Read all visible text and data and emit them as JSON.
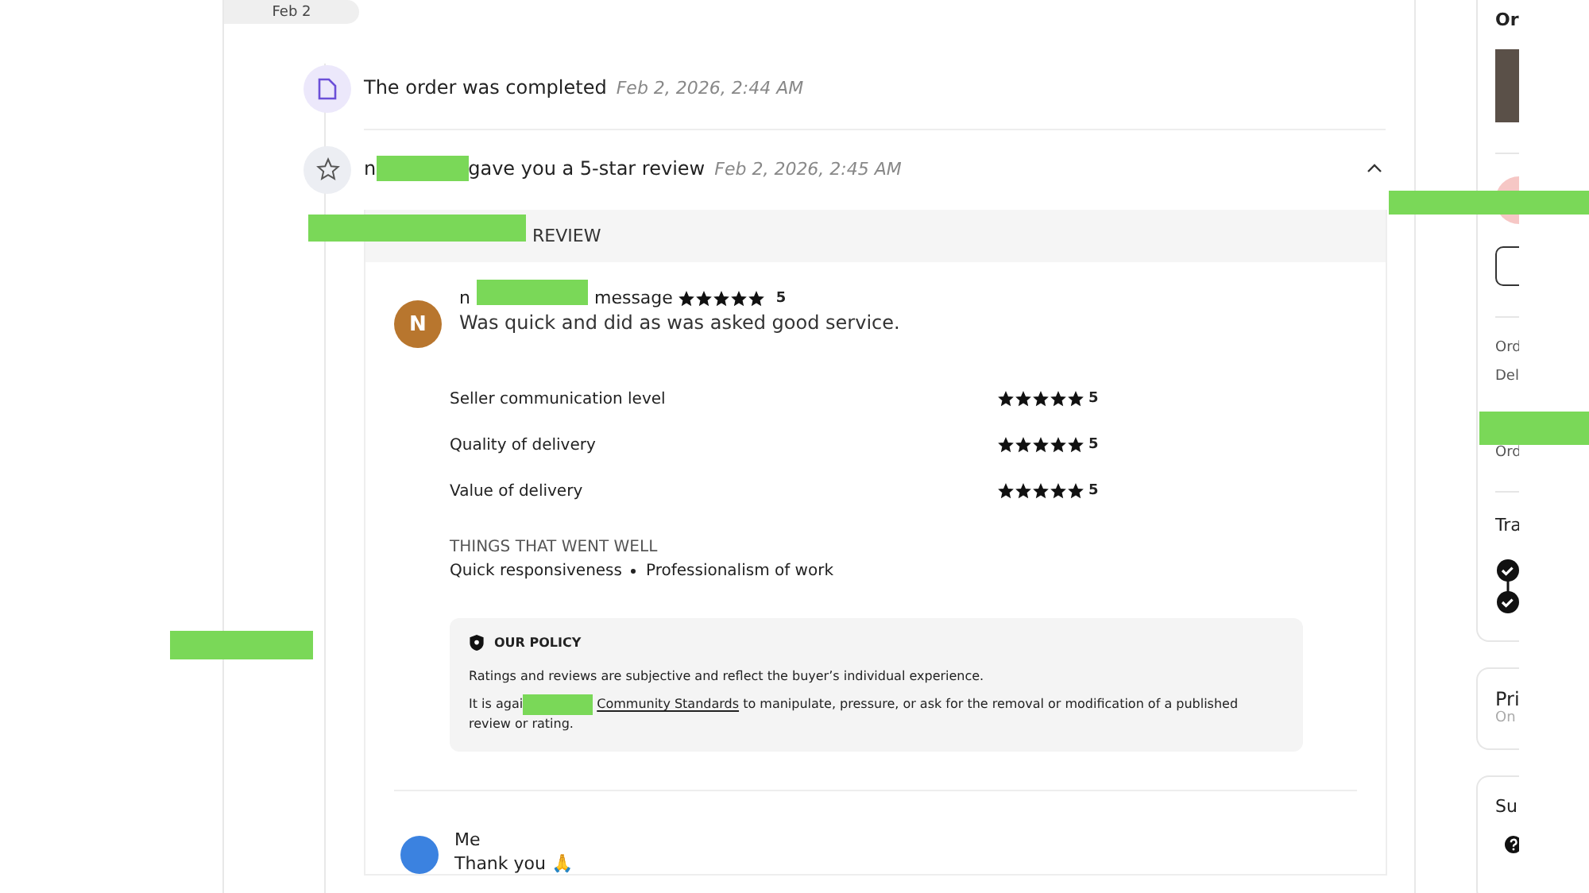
{
  "date_pill": "Feb 2",
  "events": [
    {
      "kind": "document",
      "text": "The order was completed",
      "time": "Feb 2, 2026, 2:44 AM"
    },
    {
      "kind": "star",
      "text": "gave you a 5-star review",
      "time": "Feb 2, 2026, 2:45 AM",
      "redacted_prefix": "n",
      "expanded": true
    }
  ],
  "review": {
    "header": "REVIEW",
    "reviewer_initial": "N",
    "reviewer_prefix": "n",
    "reviewer_suffix": "message",
    "stars": 5,
    "score": "5",
    "comment": "Was quick and did as was asked good service.",
    "ratings": [
      {
        "label": "Seller communication level",
        "stars": 5,
        "score": "5"
      },
      {
        "label": "Quality of delivery",
        "stars": 5,
        "score": "5"
      },
      {
        "label": "Value of delivery",
        "stars": 5,
        "score": "5"
      }
    ],
    "went_well_title": "THINGS THAT WENT WELL",
    "went_well": [
      "Quick responsiveness",
      "Professionalism of work"
    ],
    "policy": {
      "title": "OUR POLICY",
      "line1": "Ratings and reviews are subjective and reflect the buyer’s individual experience.",
      "line2_prefix": "It is agai",
      "link": "Community Standards",
      "line2_suffix": "to manipulate, pressure, or ask for the removal or modification of a published",
      "line3": "review or rating."
    }
  },
  "reply": {
    "author": "Me",
    "text": "Thank you 🙏"
  },
  "sidebar": {
    "order_title": "Or",
    "details": [
      "Ord",
      "Del",
      "Ord"
    ],
    "track_title": "Tra",
    "private_title": "Pri",
    "private_sub": "On",
    "support_title": "Su"
  }
}
